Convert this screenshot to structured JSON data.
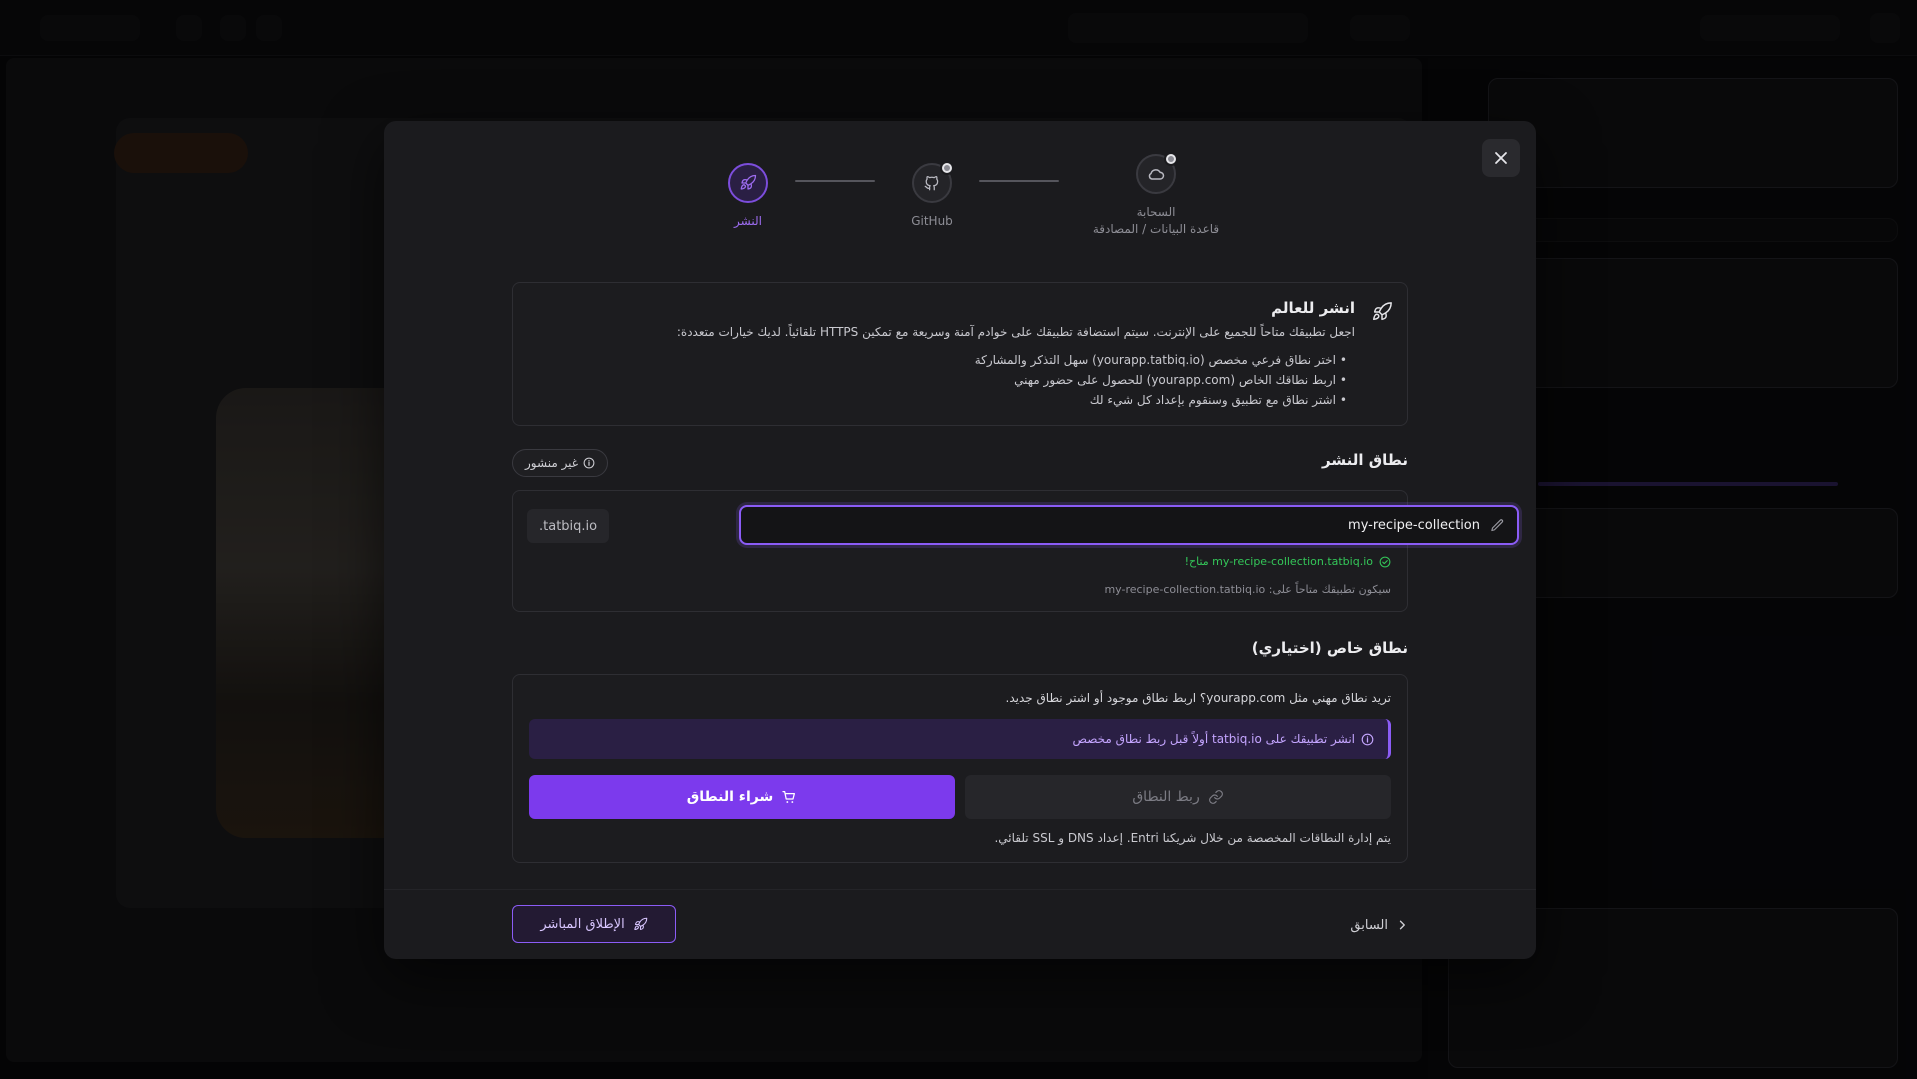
{
  "colors": {
    "accent": "#7c3aed",
    "accent_light": "#8b5cf6",
    "success": "#34c759",
    "modal_bg": "#1b1b1e"
  },
  "stepper": {
    "steps": [
      {
        "label": "السحابة",
        "sublabel": "قاعدة البيانات / المصادقة",
        "icon": "cloud-icon",
        "state": "done"
      },
      {
        "label": "GitHub",
        "icon": "github-icon",
        "state": "done"
      },
      {
        "label": "النشر",
        "icon": "rocket-icon",
        "state": "active"
      }
    ]
  },
  "intro": {
    "title": "انشر للعالم",
    "description": "اجعل تطبيقك متاحاً للجميع على الإنترنت. سيتم استضافة تطبيقك على خوادم آمنة وسريعة مع تمكين HTTPS تلقائياً. لديك خيارات متعددة:",
    "bullets": [
      "اختر نطاق فرعي مخصص (yourapp.tatbiq.io) سهل التذكر والمشاركة",
      "اربط نطاقك الخاص (yourapp.com) للحصول على حضور مهني",
      "اشتر نطاق مع تطبيق وسنقوم بإعداد كل شيء لك"
    ]
  },
  "publish_domain": {
    "title": "نطاق النشر",
    "status": "غير منشور",
    "subdomain_value": "my-recipe-collection",
    "suffix": ".tatbiq.io",
    "available_text": "my-recipe-collection.tatbiq.io متاح!",
    "will_be_text": "سيكون تطبيقك متاحاً على: my-recipe-collection.tatbiq.io"
  },
  "custom_domain": {
    "title": "نطاق خاص (اختياري)",
    "description": "تريد نطاق مهني مثل yourapp.com؟ اربط نطاق موجود أو اشتر نطاق جديد.",
    "notice": "انشر تطبيقك على tatbiq.io أولاً قبل ربط نطاق مخصص",
    "buy_label": "شراء النطاق",
    "link_label": "ربط النطاق",
    "footnote": "يتم إدارة النطاقات المخصصة من خلال شريكنا Entri. إعداد DNS و SSL تلقائي."
  },
  "footer": {
    "prev_label": "السابق",
    "launch_label": "الإطلاق المباشر"
  }
}
